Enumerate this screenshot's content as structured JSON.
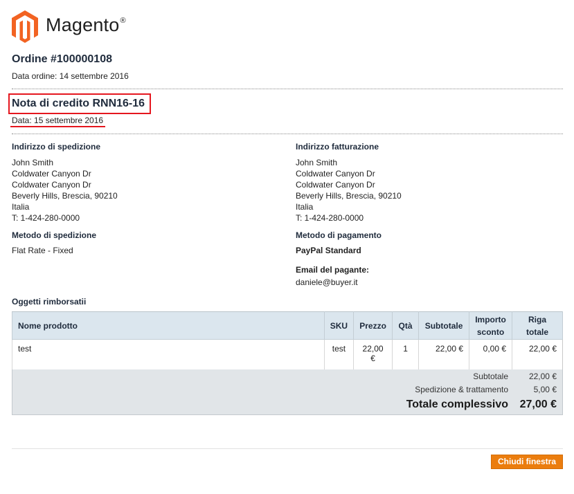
{
  "brand": {
    "name": "Magento",
    "reg_mark": "®"
  },
  "order": {
    "title": "Ordine #100000108",
    "date": "Data ordine: 14 settembre 2016"
  },
  "credit_memo": {
    "title": "Nota di credito RNN16-16",
    "date": "Data: 15 settembre 2016"
  },
  "shipping_address": {
    "title": "Indirizzo di spedizione",
    "lines": [
      "John Smith",
      "Coldwater Canyon Dr",
      "Coldwater Canyon Dr",
      "Beverly Hills, Brescia, 90210",
      "Italia",
      "T: 1-424-280-0000"
    ]
  },
  "billing_address": {
    "title": "Indirizzo fatturazione",
    "lines": [
      "John Smith",
      "Coldwater Canyon Dr",
      "Coldwater Canyon Dr",
      "Beverly Hills, Brescia, 90210",
      "Italia",
      "T: 1-424-280-0000"
    ]
  },
  "shipping_method": {
    "title": "Metodo di spedizione",
    "value": "Flat Rate - Fixed"
  },
  "payment_method": {
    "title": "Metodo di pagamento",
    "value": "PayPal Standard",
    "payer_email_label": "Email del pagante:",
    "payer_email": "daniele@buyer.it"
  },
  "items": {
    "title": "Oggetti rimborsatii",
    "columns": [
      "Nome prodotto",
      "SKU",
      "Prezzo",
      "Qtà",
      "Subtotale",
      "Importo sconto",
      "Riga totale"
    ],
    "rows": [
      {
        "name": "test",
        "sku": "test",
        "price": "22,00 €",
        "qty": "1",
        "subtotal": "22,00 €",
        "discount": "0,00 €",
        "row_total": "22,00 €"
      }
    ]
  },
  "totals": {
    "subtotal_label": "Subtotale",
    "subtotal": "22,00 €",
    "shipping_label": "Spedizione & trattamento",
    "shipping": "5,00 €",
    "grand_label": "Totale complessivo",
    "grand": "27,00 €"
  },
  "close_button": "Chiudi finestra",
  "colors": {
    "accent": "#eb7d0e",
    "highlight": "#e5161e",
    "logo": "#f26322",
    "header_bg": "#dbe6ee"
  }
}
